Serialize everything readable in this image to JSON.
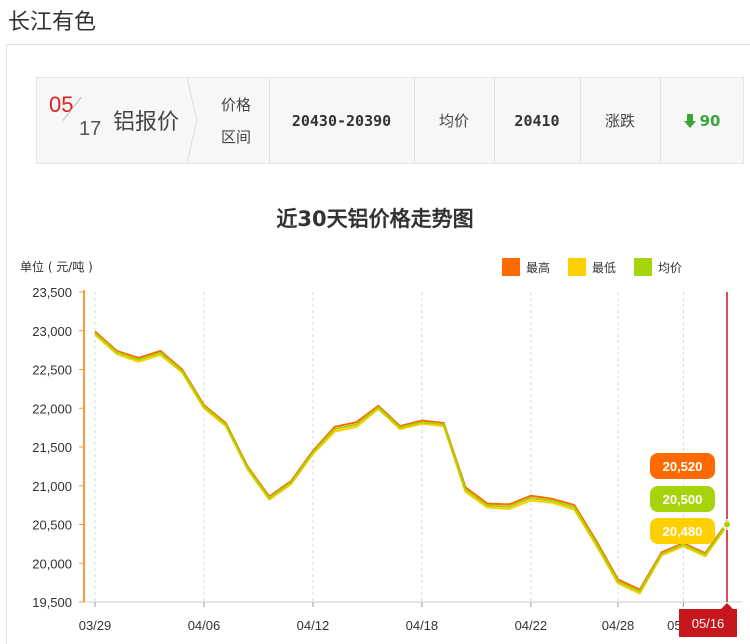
{
  "site": {
    "title": "长江有色"
  },
  "price_bar": {
    "month": "05",
    "day": "17",
    "metal_label": "铝报价",
    "range_label_1": "价格",
    "range_label_2": "区间",
    "range_value": "20430-20390",
    "avg_label": "均价",
    "avg_value": "20410",
    "change_label": "涨跌",
    "change_value": "90",
    "change_direction": "down",
    "change_color": "#3aa63a"
  },
  "chart_data": {
    "type": "line",
    "title": "近30天铝价格走势图",
    "unit_label": "单位 ( 元/吨 )",
    "ylim": [
      19500,
      23500
    ],
    "yticks": [
      19500,
      20000,
      20500,
      21000,
      21500,
      22000,
      22500,
      23000,
      23500
    ],
    "ytick_labels": [
      "19,500",
      "20,000",
      "20,500",
      "21,000",
      "21,500",
      "22,000",
      "22,500",
      "23,000",
      "23,500"
    ],
    "xtick_labels": [
      "03/29",
      "04/06",
      "04/12",
      "04/18",
      "04/22",
      "04/28",
      "05/09"
    ],
    "x_highlight_label": "05/16",
    "legend": [
      {
        "name": "最高",
        "color": "#ff6a00"
      },
      {
        "name": "最低",
        "color": "#ffd000"
      },
      {
        "name": "均价",
        "color": "#a6d40a"
      }
    ],
    "grid": "vertical dashed",
    "series": [
      {
        "name": "最高",
        "color": "#ff6a00",
        "values": [
          22990,
          22740,
          22650,
          22740,
          22500,
          22040,
          21810,
          21250,
          20860,
          21060,
          21450,
          21760,
          21820,
          22030,
          21770,
          21840,
          21810,
          20980,
          20770,
          20760,
          20870,
          20830,
          20750,
          20290,
          19790,
          19660,
          20140,
          20260,
          20130,
          20520
        ]
      },
      {
        "name": "最低",
        "color": "#ffd000",
        "values": [
          22950,
          22700,
          22600,
          22690,
          22460,
          22000,
          21770,
          21210,
          20820,
          21020,
          21410,
          21700,
          21760,
          21990,
          21730,
          21800,
          21770,
          20920,
          20720,
          20700,
          20810,
          20780,
          20690,
          20230,
          19740,
          19610,
          20100,
          20220,
          20090,
          20480
        ]
      },
      {
        "name": "均价",
        "color": "#a6d40a",
        "values": [
          22970,
          22720,
          22625,
          22715,
          22480,
          22020,
          21790,
          21230,
          20840,
          21040,
          21430,
          21730,
          21790,
          22010,
          21750,
          21820,
          21790,
          20950,
          20745,
          20730,
          20840,
          20805,
          20720,
          20260,
          19765,
          19635,
          20120,
          20240,
          20110,
          20500
        ]
      }
    ],
    "tooltip_values": [
      {
        "label": "20,520",
        "color": "#ff6a00"
      },
      {
        "label": "20,500",
        "color": "#a6d40a"
      },
      {
        "label": "20,480",
        "color": "#ffd000"
      }
    ]
  }
}
